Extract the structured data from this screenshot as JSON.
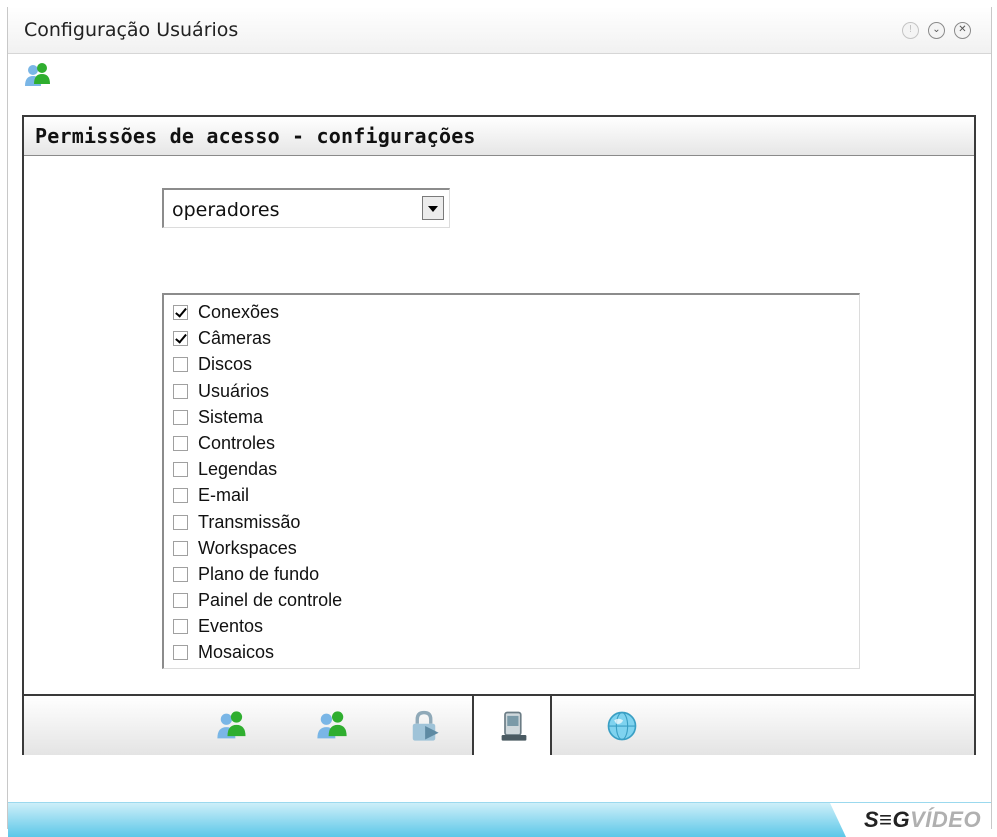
{
  "window": {
    "title": "Configuração Usuários"
  },
  "panel": {
    "title": "Permissões de acesso - configurações",
    "group_select": {
      "value": "operadores"
    },
    "permissions": [
      {
        "label": "Conexões",
        "checked": true
      },
      {
        "label": "Câmeras",
        "checked": true
      },
      {
        "label": "Discos",
        "checked": false
      },
      {
        "label": "Usuários",
        "checked": false
      },
      {
        "label": "Sistema",
        "checked": false
      },
      {
        "label": "Controles",
        "checked": false
      },
      {
        "label": "Legendas",
        "checked": false
      },
      {
        "label": "E-mail",
        "checked": false
      },
      {
        "label": "Transmissão",
        "checked": false
      },
      {
        "label": "Workspaces",
        "checked": false
      },
      {
        "label": "Plano de fundo",
        "checked": false
      },
      {
        "label": "Painel de controle",
        "checked": false
      },
      {
        "label": "Eventos",
        "checked": false
      },
      {
        "label": "Mosaicos",
        "checked": false
      }
    ]
  },
  "bottom_tabs": [
    {
      "icon": "users-icon",
      "active": false
    },
    {
      "icon": "users-group-icon",
      "active": false
    },
    {
      "icon": "lock-permissions-icon",
      "active": false
    },
    {
      "icon": "device-settings-icon",
      "active": true
    },
    {
      "icon": "globe-icon",
      "active": false
    }
  ],
  "footer": {
    "logo_seg": "S≡G",
    "logo_video": "VÍDEO"
  },
  "colors": {
    "footer_accent": "#5cc7e8",
    "user_icon_green": "#2fae2f",
    "user_icon_blue": "#7ab6e6"
  }
}
